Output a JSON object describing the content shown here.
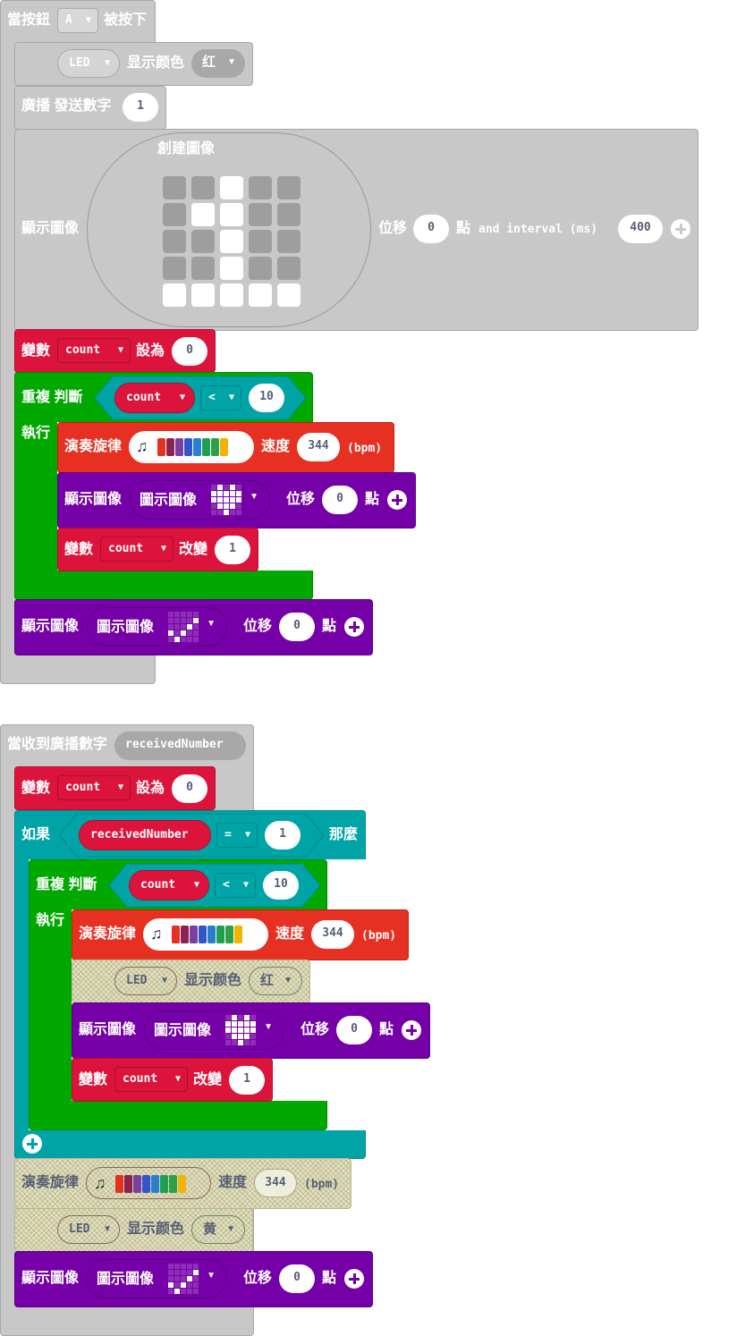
{
  "block1": {
    "hat_label": "當按鈕",
    "button_value": "A",
    "hat_suffix": "被按下",
    "led": {
      "target": "LED",
      "label": "显示颜色",
      "color": "红"
    },
    "radio": {
      "label": "廣播 發送數字",
      "value": "1"
    },
    "show_image": {
      "label": "顯示圖像",
      "create_label": "創建圖像",
      "offset_label": "位移",
      "offset": "0",
      "point_label": "點",
      "interval_label": "and interval (ms)",
      "interval": "400",
      "grid": [
        [
          0,
          0,
          1,
          0,
          0
        ],
        [
          0,
          1,
          1,
          0,
          0
        ],
        [
          0,
          0,
          1,
          0,
          0
        ],
        [
          0,
          0,
          1,
          0,
          0
        ],
        [
          1,
          1,
          1,
          1,
          1
        ]
      ]
    },
    "set_var": {
      "label": "變數",
      "var": "count",
      "to": "設為",
      "value": "0"
    },
    "while": {
      "repeat": "重複",
      "judge": "判斷",
      "var": "count",
      "op": "<",
      "value": "10",
      "do": "執行"
    },
    "melody": {
      "label": "演奏旋律",
      "speed_label": "速度",
      "speed": "344",
      "unit": "(bpm)"
    },
    "show_icon": {
      "label": "顯示圖像",
      "sub": "圖示圖像",
      "offset_label": "位移",
      "offset": "0",
      "point_label": "點"
    },
    "change_var": {
      "label": "變數",
      "var": "count",
      "op": "改變",
      "value": "1"
    },
    "show_icon2": {
      "label": "顯示圖像",
      "sub": "圖示圖像",
      "offset_label": "位移",
      "offset": "0",
      "point_label": "點"
    }
  },
  "block2": {
    "hat_label": "當收到廣播數字",
    "param": "receivedNumber",
    "set_var": {
      "label": "變數",
      "var": "count",
      "to": "設為",
      "value": "0"
    },
    "if": {
      "label": "如果",
      "lhs": "receivedNumber",
      "op": "=",
      "rhs": "1",
      "then": "那麼"
    },
    "while": {
      "repeat": "重複",
      "judge": "判斷",
      "var": "count",
      "op": "<",
      "value": "10",
      "do": "執行"
    },
    "melody": {
      "label": "演奏旋律",
      "speed_label": "速度",
      "speed": "344",
      "unit": "(bpm)"
    },
    "led": {
      "target": "LED",
      "label": "显示颜色",
      "color": "红"
    },
    "show_icon": {
      "label": "顯示圖像",
      "sub": "圖示圖像",
      "offset_label": "位移",
      "offset": "0",
      "point_label": "點"
    },
    "change_var": {
      "label": "變數",
      "var": "count",
      "op": "改變",
      "value": "1"
    },
    "melody2": {
      "label": "演奏旋律",
      "speed_label": "速度",
      "speed": "344",
      "unit": "(bpm)"
    },
    "led2": {
      "target": "LED",
      "label": "显示颜色",
      "color": "黄"
    },
    "show_icon2": {
      "label": "顯示圖像",
      "sub": "圖示圖像",
      "offset_label": "位移",
      "offset": "0",
      "point_label": "點"
    }
  },
  "colors": {
    "event": "#c8c8c8",
    "event_border": "#a8a8a8",
    "variables": "#dc143c",
    "loops": "#00a800",
    "logic": "#00a4a6",
    "music": "#e63022",
    "basic": "#7600a8",
    "disabled": "#d6d3a8"
  },
  "melody_colors": [
    "#e63022",
    "#8b2252",
    "#7b3fa0",
    "#3355cc",
    "#2a7fcc",
    "#1fa050",
    "#2ea04a",
    "#f2b400"
  ]
}
